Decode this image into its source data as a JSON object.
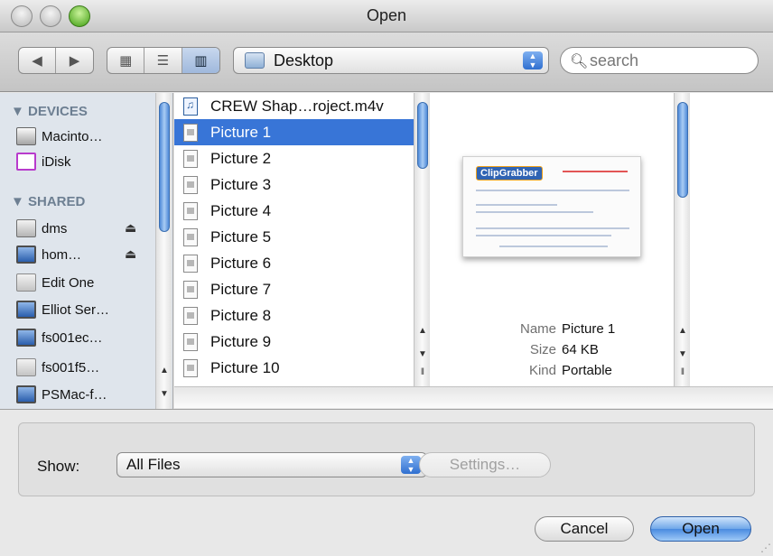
{
  "window": {
    "title": "Open"
  },
  "toolbar": {
    "back_glyph": "◀",
    "forward_glyph": "▶",
    "view_icon_glyph": "▦",
    "view_list_glyph": "☰",
    "view_column_glyph": "▥",
    "location": "Desktop",
    "search_placeholder": "search"
  },
  "sidebar": {
    "devices_header": "▼ DEVICES",
    "shared_header": "▼ SHARED",
    "devices": [
      "Macinto…",
      "iDisk"
    ],
    "shared": [
      "dms",
      "hom…",
      "Edit One",
      "Elliot Ser…",
      "fs001ec…",
      "fs001f5…",
      "PSMac-f…"
    ],
    "eject_glyph": "⏏"
  },
  "files": [
    "CREW Shap…roject.m4v",
    "Picture 1",
    "Picture 2",
    "Picture 3",
    "Picture 4",
    "Picture 5",
    "Picture 6",
    "Picture 7",
    "Picture 8",
    "Picture 9",
    "Picture 10"
  ],
  "selected_file": "Picture 1",
  "preview": {
    "logo_text": "ClipGrabber",
    "name_label": "Name",
    "name_value": "Picture 1",
    "size_label": "Size",
    "size_value": "64 KB",
    "kind_label": "Kind",
    "kind_value": "Portable"
  },
  "bottom": {
    "show_label": "Show:",
    "show_value": "All Files",
    "settings_label": "Settings…",
    "cancel_label": "Cancel",
    "open_label": "Open"
  },
  "colors": {
    "selection": "#3875d7",
    "accent": "#4a8be0"
  }
}
